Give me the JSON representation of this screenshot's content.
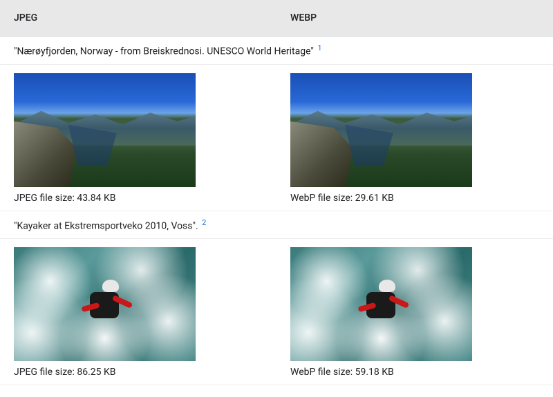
{
  "headers": {
    "jpeg": "JPEG",
    "webp": "WEBP"
  },
  "rows": [
    {
      "caption": "\"Nærøyfjorden, Norway - from Breiskrednosi. UNESCO World Heritage\"",
      "footnote": "1",
      "jpeg_size": "JPEG file size: 43.84 KB",
      "webp_size": "WebP file size: 29.61 KB"
    },
    {
      "caption": "\"Kayaker at Ekstremsportveko 2010, Voss\".",
      "footnote": "2",
      "jpeg_size": "JPEG file size: 86.25 KB",
      "webp_size": "WebP file size: 59.18 KB"
    }
  ]
}
